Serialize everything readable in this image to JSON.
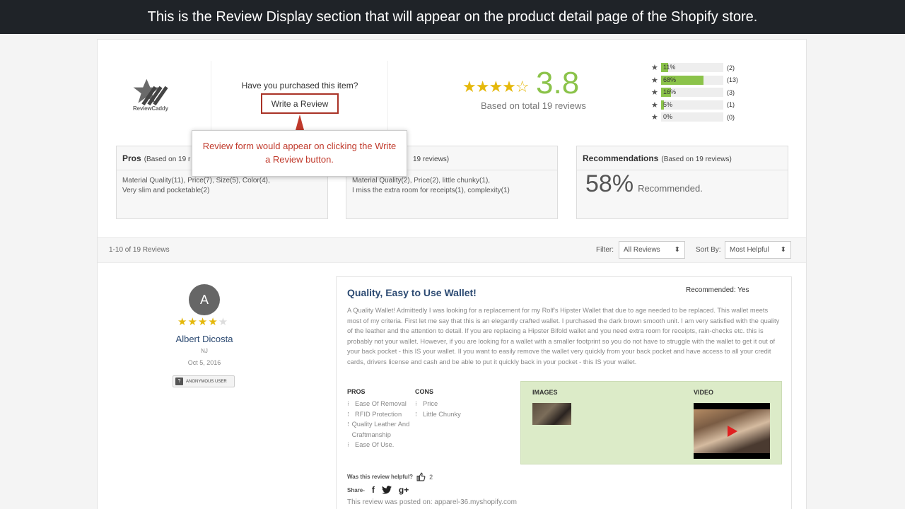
{
  "banner": {
    "text": "This is the Review Display section that will appear on the product detail page of the Shopify store."
  },
  "header": {
    "logo_text": "ReviewCaddy",
    "purchased_question": "Have you purchased this item?",
    "write_review_label": "Write a Review",
    "overall_stars": "★★★★☆",
    "overall_score": "3.8",
    "based_on_total": "Based on total 19 reviews"
  },
  "rating_breakdown": [
    {
      "star": "★",
      "percent_label": "11%",
      "fraction": 0.11,
      "count": "(2)"
    },
    {
      "star": "★",
      "percent_label": "68%",
      "fraction": 0.68,
      "count": "(13)"
    },
    {
      "star": "★",
      "percent_label": "16%",
      "fraction": 0.16,
      "count": "(3)"
    },
    {
      "star": "★",
      "percent_label": "5%",
      "fraction": 0.05,
      "count": "(1)"
    },
    {
      "star": "★",
      "percent_label": "0%",
      "fraction": 0.0,
      "count": "(0)"
    }
  ],
  "tooltip": {
    "text": "Review form would appear on clicking the Write a Review button."
  },
  "pros_box": {
    "title": "Pros",
    "subtitle": "(Based on 19 r",
    "items_line1": "Material Quality(11), Price(7), Size(5), Color(4),",
    "items_line2": "Very slim and pocketable(2)"
  },
  "cons_box": {
    "subtitle": "19 reviews)",
    "items_line1": "Material Quality(2), Price(2), little chunky(1),",
    "items_line2": "I miss the extra room for receipts(1), complexity(1)"
  },
  "recommend_box": {
    "title": "Recommendations",
    "subtitle": "(Based on 19 reviews)",
    "percent": "58%",
    "label": "Recommended."
  },
  "filterbar": {
    "count_label": "1-10 of 19 Reviews",
    "filter_label": "Filter:",
    "filter_value": "All Reviews",
    "sort_label": "Sort By:",
    "sort_value": "Most Helpful",
    "select_arrow": "⬍"
  },
  "reviewer": {
    "initial": "A",
    "stars_on": "★★★★",
    "stars_off": "★",
    "name": "Albert Dicosta",
    "state": "NJ",
    "date": "Oct 5, 2016",
    "badge_icon": "?",
    "badge_label": "ANONYMOUS USER"
  },
  "review": {
    "title": "Quality, Easy to Use Wallet!",
    "recommended_label": "Recommended:",
    "recommended_value": "Yes",
    "body": "A Quality Wallet! Admittedly I was looking for a replacement for my Rolf's Hipster Wallet that due to age needed to be replaced. This wallet meets most of my criteria. First let me say that this is an elegantly crafted wallet. I purchased the dark brown smooth unit. I am very satisfied with the quality of the leather and the attention to detail. If you are replacing a Hipster Bifold wallet and you need extra room for receipts, rain-checks etc. this is probably not your wallet. However, if you are looking for a wallet with a smaller footprint so you do not have to struggle with the wallet to get it out of your back pocket - this IS your wallet. II you want to easily remove the wallet very quickly from your back pocket and have access to all your credit cards, drivers license and cash and be able to put it quickly back in your pocket - this IS your wallet.",
    "pros_heading": "PROS",
    "pros": [
      "Ease Of Removal",
      "RFID Protection",
      "Quality Leather And Craftmanship",
      "Ease Of Use."
    ],
    "cons_heading": "CONS",
    "cons": [
      "Price",
      "Little Chunky"
    ],
    "images_heading": "IMAGES",
    "video_heading": "VIDEO",
    "helpful_label": "Was this review helpful?",
    "helpful_count": "2",
    "share_label": "Share-",
    "posted_on": "This review was posted on: apparel-36.myshopify.com"
  },
  "icons": {
    "bullet": "⁝",
    "thumbs_up": "👍",
    "facebook": "f",
    "google_plus": "g+"
  },
  "colors": {
    "accent_green": "#8bc34a",
    "star_gold": "#e5b80b",
    "title_blue": "#2c4a72",
    "tooltip_red": "#c0392b",
    "media_bg": "#dcebc8"
  }
}
